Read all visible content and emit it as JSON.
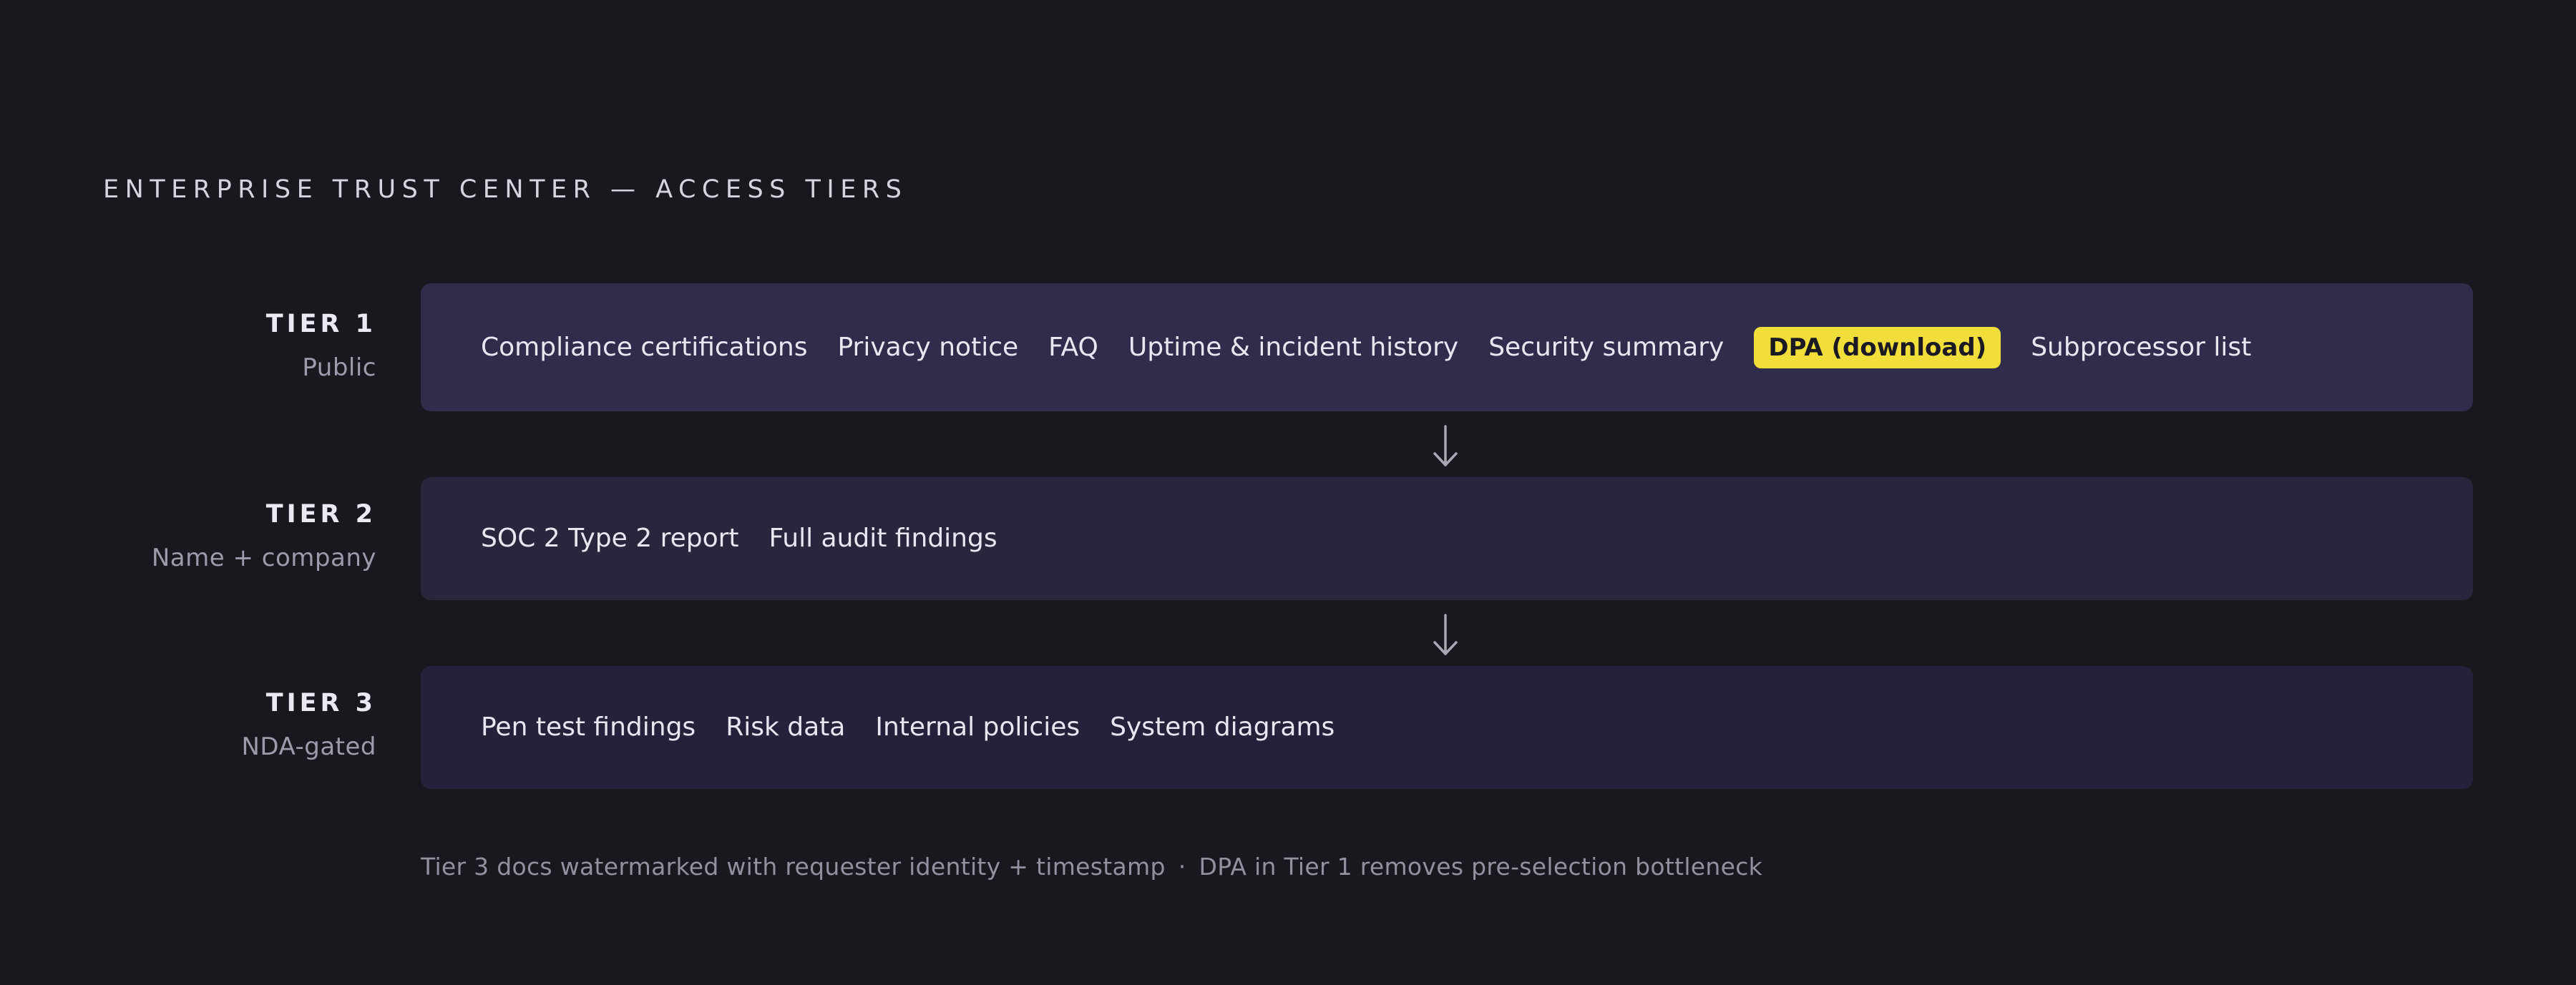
{
  "title": "ENTERPRISE TRUST CENTER — ACCESS TIERS",
  "tiers": [
    {
      "name": "TIER 1",
      "access": "Public",
      "items": [
        "Compliance certifications",
        "Privacy notice",
        "FAQ",
        "Uptime & incident history",
        "Security summary",
        "DPA (download)",
        "Subprocessor list"
      ],
      "highlighted_item": "DPA (download)"
    },
    {
      "name": "TIER 2",
      "access": "Name + company",
      "items": [
        "SOC 2 Type 2 report",
        "Full audit findings"
      ]
    },
    {
      "name": "TIER 3",
      "access": "NDA-gated",
      "items": [
        "Pen test findings",
        "Risk data",
        "Internal policies",
        "System diagrams"
      ]
    }
  ],
  "footnote": {
    "left": "Tier 3 docs watermarked with requester identity + timestamp",
    "separator": "·",
    "right": "DPA in Tier 1 removes pre-selection bottleneck"
  },
  "colors": {
    "background": "#18181f",
    "tier1_box": "#302c4b",
    "tier2_box": "#28263c",
    "tier3_box": "#24223a",
    "highlight": "#f2de3a",
    "arrow": "#a9a6b6"
  },
  "icons": {
    "flow_arrow": "arrow-down-icon"
  }
}
